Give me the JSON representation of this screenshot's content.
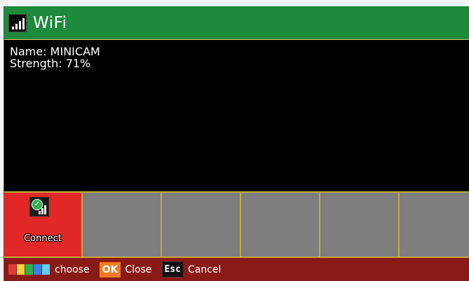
{
  "window": {
    "title": "WiFi"
  },
  "info": {
    "name_line": "Name: MINICAM",
    "strength_line": "Strength: 71%"
  },
  "buttons": [
    {
      "label": "Connect",
      "active": true,
      "icon": "wifi-connect-icon"
    },
    {
      "label": "",
      "active": false
    },
    {
      "label": "",
      "active": false
    },
    {
      "label": "",
      "active": false
    },
    {
      "label": "",
      "active": false
    },
    {
      "label": "",
      "active": false
    }
  ],
  "statusbar": {
    "choose_label": "choose",
    "ok_key": "OK",
    "ok_label": "Close",
    "esc_key": "Esc",
    "esc_label": "Cancel",
    "swatch_colors": [
      "#e33b3b",
      "#f2d23a",
      "#2fb04a",
      "#3b7fe0",
      "#5fd0e8"
    ]
  },
  "colors": {
    "titlebar": "#1e8a3c",
    "active_button": "#e22727",
    "statusbar": "#8a1a18"
  }
}
